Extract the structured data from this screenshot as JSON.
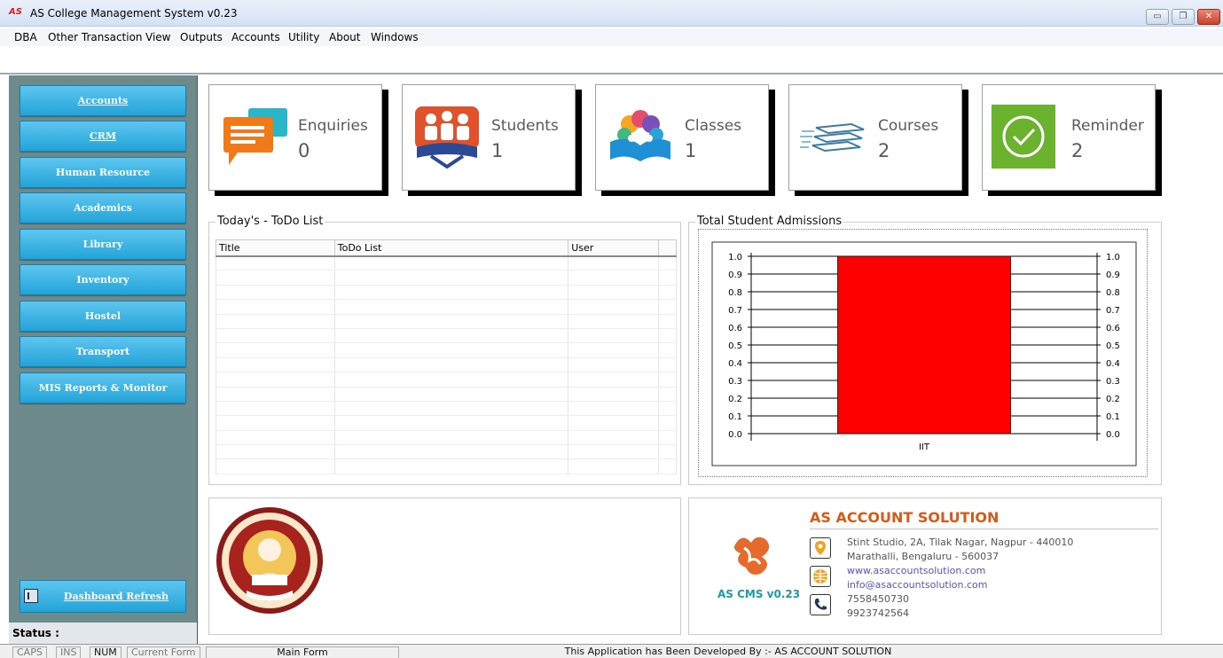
{
  "window": {
    "logo_text": "AS",
    "title": "AS College Management System v0.23",
    "minimize_label": "▭",
    "restore_label": "❐",
    "close_label": "✕"
  },
  "menu": [
    "DBA",
    "Other Transaction",
    "View",
    "Outputs",
    "Accounts",
    "Utility",
    "About",
    "Windows"
  ],
  "sidebar": {
    "items": [
      {
        "label": "Accounts",
        "icon": "none"
      },
      {
        "label": "CRM",
        "icon": "none"
      },
      {
        "label": "Human Resource",
        "icon": "none"
      },
      {
        "label": "Academics",
        "icon": "none"
      },
      {
        "label": "Library",
        "icon": "none"
      },
      {
        "label": "Inventory",
        "icon": "none"
      },
      {
        "label": "Hostel",
        "icon": "none"
      },
      {
        "label": "Transport",
        "icon": "none"
      },
      {
        "label": "MIS Reports & Monitor",
        "icon": "none"
      }
    ],
    "refresh_label": "Dashboard Refresh",
    "status_label": "Status :"
  },
  "cards": [
    {
      "title": "Enquiries",
      "count": "0",
      "icon": "chat-bubbles-icon"
    },
    {
      "title": "Students",
      "count": "1",
      "icon": "students-icon"
    },
    {
      "title": "Classes",
      "count": "1",
      "icon": "book-icon"
    },
    {
      "title": "Courses",
      "count": "2",
      "icon": "stack-icon"
    },
    {
      "title": "Reminder",
      "count": "2",
      "icon": "clock-icon"
    }
  ],
  "todo": {
    "group_title": "Today's - ToDo List",
    "columns": [
      "Title",
      "ToDo List",
      "User"
    ]
  },
  "admissions": {
    "group_title": "Total Student Admissions"
  },
  "chart_data": {
    "type": "bar",
    "categories": [
      "IIT"
    ],
    "values": [
      1.0
    ],
    "title": "Total Student Admissions",
    "xlabel": "",
    "ylabel": "",
    "ylim": [
      0.0,
      1.0
    ],
    "yticks": [
      "0.0",
      "0.1",
      "0.2",
      "0.3",
      "0.4",
      "0.5",
      "0.6",
      "0.7",
      "0.8",
      "0.9",
      "1.0"
    ],
    "grid": true,
    "legend": "none",
    "colors": {
      "bar": "#ff0000"
    }
  },
  "company": {
    "name": "AS ACCOUNT SOLUTION",
    "product": "AS CMS v0.23",
    "address1": "Stint Studio, 2A, Tilak Nagar, Nagpur - 440010",
    "address2": "Marathalli, Bengaluru - 560037",
    "website": "www.asaccountsolution.com",
    "email": "info@asaccountsolution.com",
    "phone1": "7558450730",
    "phone2": "9923742564"
  },
  "statusbar": {
    "caps": "CAPS",
    "ins": "INS",
    "num": "NUM",
    "current_form_label": "Current Form",
    "current_form": "Main Form",
    "message": "This Application has Been Developed By :- AS ACCOUNT SOLUTION"
  },
  "colors": {
    "sidebar_bg": "#6f8a8a",
    "nav_button": "#23a3d8",
    "accent": "#d45a16",
    "bar": "#ff0000"
  }
}
